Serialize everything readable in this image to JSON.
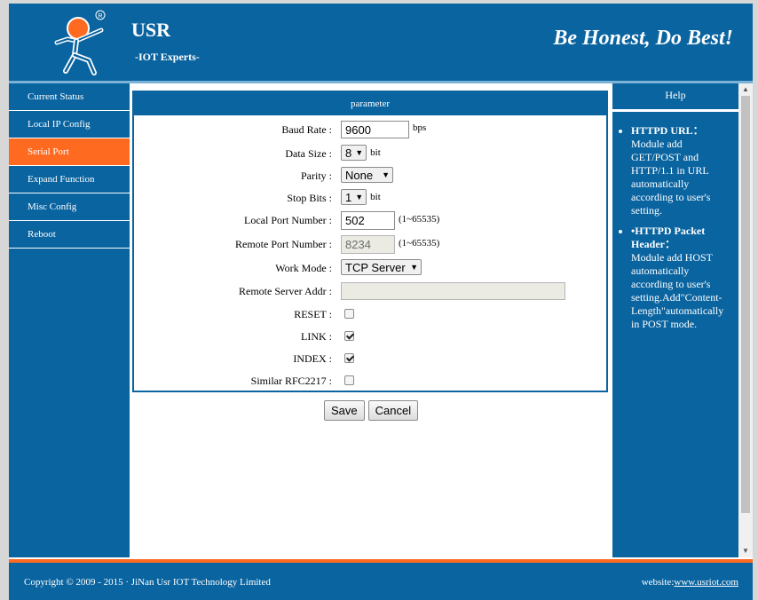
{
  "header": {
    "brand": "USR",
    "tagline": "-IOT Experts-",
    "slogan": "Be Honest, Do Best!"
  },
  "sidebar": {
    "items": [
      {
        "label": "Current Status",
        "active": false
      },
      {
        "label": "Local IP Config",
        "active": false
      },
      {
        "label": "Serial Port",
        "active": true
      },
      {
        "label": "Expand Function",
        "active": false
      },
      {
        "label": "Misc Config",
        "active": false
      },
      {
        "label": "Reboot",
        "active": false
      }
    ]
  },
  "main": {
    "header": "parameter",
    "fields": {
      "baud_rate": {
        "label": "Baud Rate :",
        "value": "9600",
        "unit": "bps"
      },
      "data_size": {
        "label": "Data Size :",
        "value": "8",
        "unit": "bit"
      },
      "parity": {
        "label": "Parity :",
        "value": "None"
      },
      "stop_bits": {
        "label": "Stop Bits :",
        "value": "1",
        "unit": "bit"
      },
      "local_port": {
        "label": "Local Port Number :",
        "value": "502",
        "range": "(1~65535)"
      },
      "remote_port": {
        "label": "Remote Port Number :",
        "value": "8234",
        "range": "(1~65535)"
      },
      "work_mode": {
        "label": "Work Mode :",
        "value": "TCP Server"
      },
      "remote_addr": {
        "label": "Remote Server Addr :",
        "value": ""
      },
      "reset": {
        "label": "RESET :",
        "checked": false
      },
      "link": {
        "label": "LINK :",
        "checked": true
      },
      "index": {
        "label": "INDEX :",
        "checked": true
      },
      "rfc2217": {
        "label": "Similar RFC2217 :",
        "checked": false
      }
    },
    "buttons": {
      "save": "Save",
      "cancel": "Cancel"
    }
  },
  "help": {
    "title": "Help",
    "items": [
      {
        "title": "HTTPD URL：",
        "text": "Module add GET/POST and HTTP/1.1 in URL automatically according to user's setting."
      },
      {
        "title": "•HTTPD Packet Header：",
        "text": "Module add HOST automatically according to user's setting.Add\"Content-Length\"automatically in POST mode."
      }
    ]
  },
  "footer": {
    "copyright": "Copyright © 2009 - 2015 · JiNan Usr IOT Technology Limited",
    "website_label": "website:",
    "website_url": "www.usriot.com"
  },
  "colors": {
    "primary": "#0a64a0",
    "accent": "#ff6a21"
  }
}
